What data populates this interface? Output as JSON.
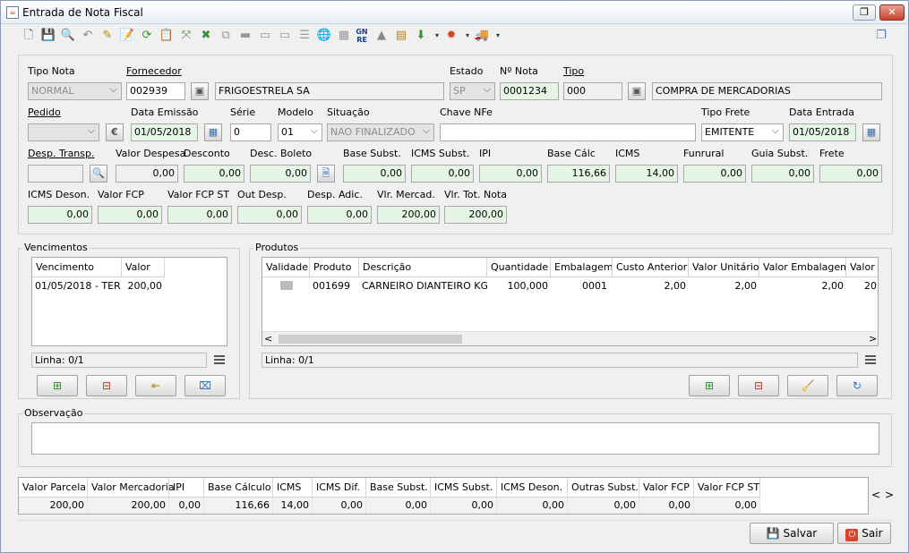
{
  "window": {
    "title": "Entrada de Nota Fiscal"
  },
  "form": {
    "tipo_nota": {
      "label": "Tipo Nota",
      "value": "NORMAL"
    },
    "fornecedor": {
      "label": "Fornecedor",
      "code": "002939",
      "name": "FRIGOESTRELA SA"
    },
    "estado": {
      "label": "Estado",
      "value": "SP"
    },
    "n_nota": {
      "label": "Nº Nota",
      "value": "0001234"
    },
    "tipo": {
      "label": "Tipo",
      "code": "000",
      "name": "COMPRA DE MERCADORIAS"
    },
    "pedido": {
      "label": "Pedido",
      "value": ""
    },
    "data_emissao": {
      "label": "Data Emissão",
      "value": "01/05/2018"
    },
    "serie": {
      "label": "Série",
      "value": "0"
    },
    "modelo": {
      "label": "Modelo",
      "value": "01"
    },
    "situacao": {
      "label": "Situação",
      "value": "NAO FINALIZADO"
    },
    "chave_nfe": {
      "label": "Chave NFe",
      "value": ""
    },
    "tipo_frete": {
      "label": "Tipo Frete",
      "value": "EMITENTE"
    },
    "data_entrada": {
      "label": "Data Entrada",
      "value": "01/05/2018"
    },
    "row3": [
      {
        "label": "Desp. Transp.",
        "value": ""
      },
      {
        "label": "Valor Despesa",
        "value": "0,00"
      },
      {
        "label": "Desconto",
        "value": "0,00"
      },
      {
        "label": "Desc. Boleto",
        "value": "0,00"
      },
      {
        "label": "Base Subst.",
        "value": "0,00"
      },
      {
        "label": "ICMS Subst.",
        "value": "0,00"
      },
      {
        "label": "IPI",
        "value": "0,00"
      },
      {
        "label": "Base Cálc",
        "value": "116,66"
      },
      {
        "label": "ICMS",
        "value": "14,00"
      },
      {
        "label": "Funrural",
        "value": "0,00"
      },
      {
        "label": "Guia Subst.",
        "value": "0,00"
      },
      {
        "label": "Frete",
        "value": "0,00"
      }
    ],
    "row4": [
      {
        "label": "ICMS Deson.",
        "value": "0,00"
      },
      {
        "label": "Valor FCP",
        "value": "0,00"
      },
      {
        "label": "Valor FCP ST",
        "value": "0,00"
      },
      {
        "label": "Out Desp.",
        "value": "0,00"
      },
      {
        "label": "Desp. Adic.",
        "value": "0,00"
      },
      {
        "label": "Vlr. Mercad.",
        "value": "200,00"
      },
      {
        "label": "Vlr. Tot. Nota",
        "value": "200,00"
      }
    ]
  },
  "vencimentos": {
    "title": "Vencimentos",
    "columns": [
      "Vencimento",
      "Valor"
    ],
    "rows": [
      [
        "01/05/2018 - TER",
        "200,00"
      ]
    ],
    "status": "Linha: 0/1"
  },
  "produtos": {
    "title": "Produtos",
    "columns": [
      "Validade",
      "Produto",
      "Descrição",
      "Quantidade",
      "Embalagem",
      "Custo Anterior",
      "Valor Unitário",
      "Valor Embalagem",
      "Valor T"
    ],
    "rows": [
      [
        "",
        "001699",
        "CARNEIRO DIANTEIRO KG",
        "100,000",
        "0001",
        "2,00",
        "2,00",
        "2,00",
        "20"
      ]
    ],
    "status": "Linha: 0/1"
  },
  "observacao": {
    "title": "Observação",
    "value": ""
  },
  "summary": {
    "columns": [
      "Valor Parcela",
      "Valor Mercadoria",
      "IPI",
      "Base Cálculo",
      "ICMS",
      "ICMS Dif.",
      "Base Subst.",
      "ICMS Subst.",
      "ICMS Deson.",
      "Outras Subst.",
      "Valor FCP",
      "Valor FCP ST"
    ],
    "values": [
      "200,00",
      "200,00",
      "0,00",
      "116,66",
      "14,00",
      "0,00",
      "0,00",
      "0,00",
      "0,00",
      "0,00",
      "0,00",
      "0,00"
    ]
  },
  "buttons": {
    "salvar": "Salvar",
    "sair": "Sair"
  },
  "glyphs": {
    "rs": "€",
    "calendar": "▦",
    "dots": "⋯",
    "left": "<",
    "right": ">",
    "prev": "‹",
    "next": "›"
  }
}
